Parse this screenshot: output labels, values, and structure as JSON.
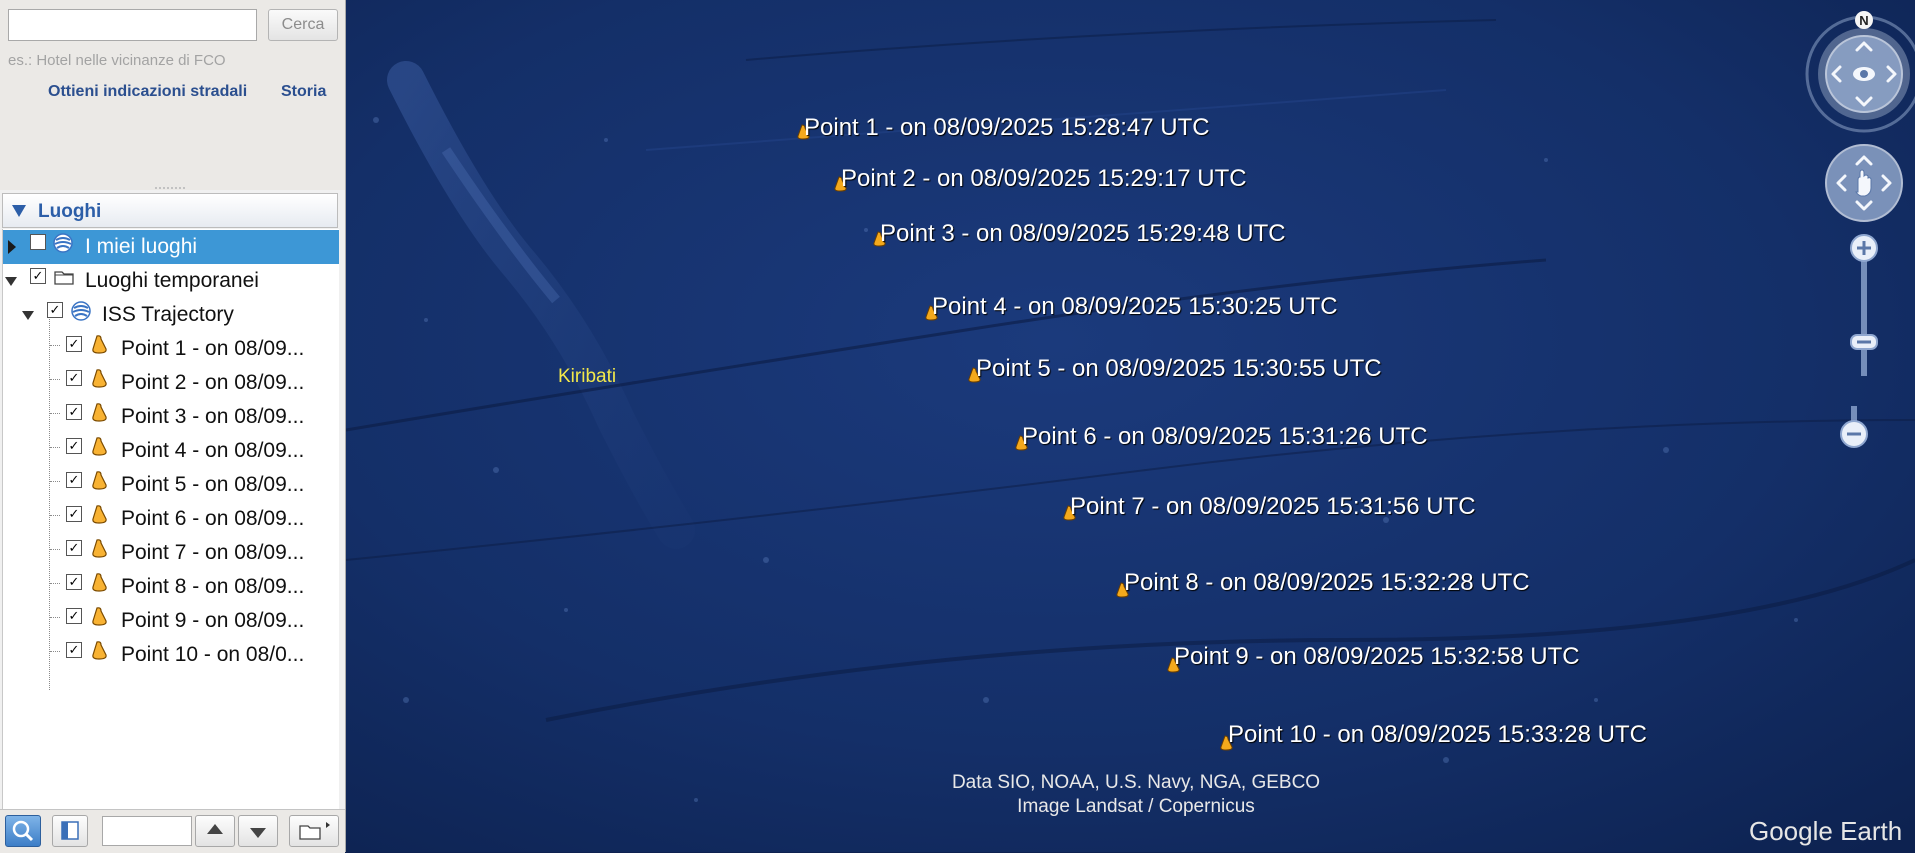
{
  "search": {
    "placeholder": "",
    "button_label": "Cerca",
    "hint": "es.: Hotel nelle vicinanze di FCO",
    "link_directions": "Ottieni indicazioni stradali",
    "link_history": "Storia"
  },
  "places": {
    "header": "Luoghi",
    "my_places": "I miei luoghi",
    "temporary": "Luoghi temporanei",
    "folder": "ISS Trajectory",
    "items": [
      "Point 1 - on 08/09...",
      "Point 2 - on 08/09...",
      "Point 3 - on 08/09...",
      "Point 4 - on 08/09...",
      "Point 5 - on 08/09...",
      "Point 6 - on 08/09...",
      "Point 7 - on 08/09...",
      "Point 8 - on 08/09...",
      "Point 9 - on 08/09...",
      "Point 10 - on 08/0..."
    ]
  },
  "map": {
    "points": [
      "Point 1 - on 08/09/2025 15:28:47 UTC",
      "Point 2 - on 08/09/2025 15:29:17 UTC",
      "Point 3 - on 08/09/2025 15:29:48 UTC",
      "Point 4 - on 08/09/2025 15:30:25 UTC",
      "Point 5 - on 08/09/2025 15:30:55 UTC",
      "Point 6 - on 08/09/2025 15:31:26 UTC",
      "Point 7 - on 08/09/2025 15:31:56 UTC",
      "Point 8 - on 08/09/2025 15:32:28 UTC",
      "Point 9 - on 08/09/2025 15:32:58 UTC",
      "Point 10 - on 08/09/2025 15:33:28 UTC"
    ],
    "region_label": "Kiribati",
    "attribution_line1": "Data SIO, NOAA, U.S. Navy, NGA, GEBCO",
    "attribution_line2": "Image Landsat / Copernicus",
    "brand": "Google Earth",
    "compass_north": "N"
  },
  "icons": {
    "search_tab": "magnifier-icon",
    "layers_tab": "panel-icon",
    "up": "arrow-up-icon",
    "down": "arrow-down-icon",
    "folder": "folder-icon",
    "placemark": "placemark-pin-icon",
    "network": "globe-network-icon"
  },
  "colors": {
    "selected_row": "#3d97d6",
    "header_text": "#2c5ea8",
    "ocean": "#14306a",
    "pin": "#f4a91c",
    "region_label": "#f2e84a"
  }
}
